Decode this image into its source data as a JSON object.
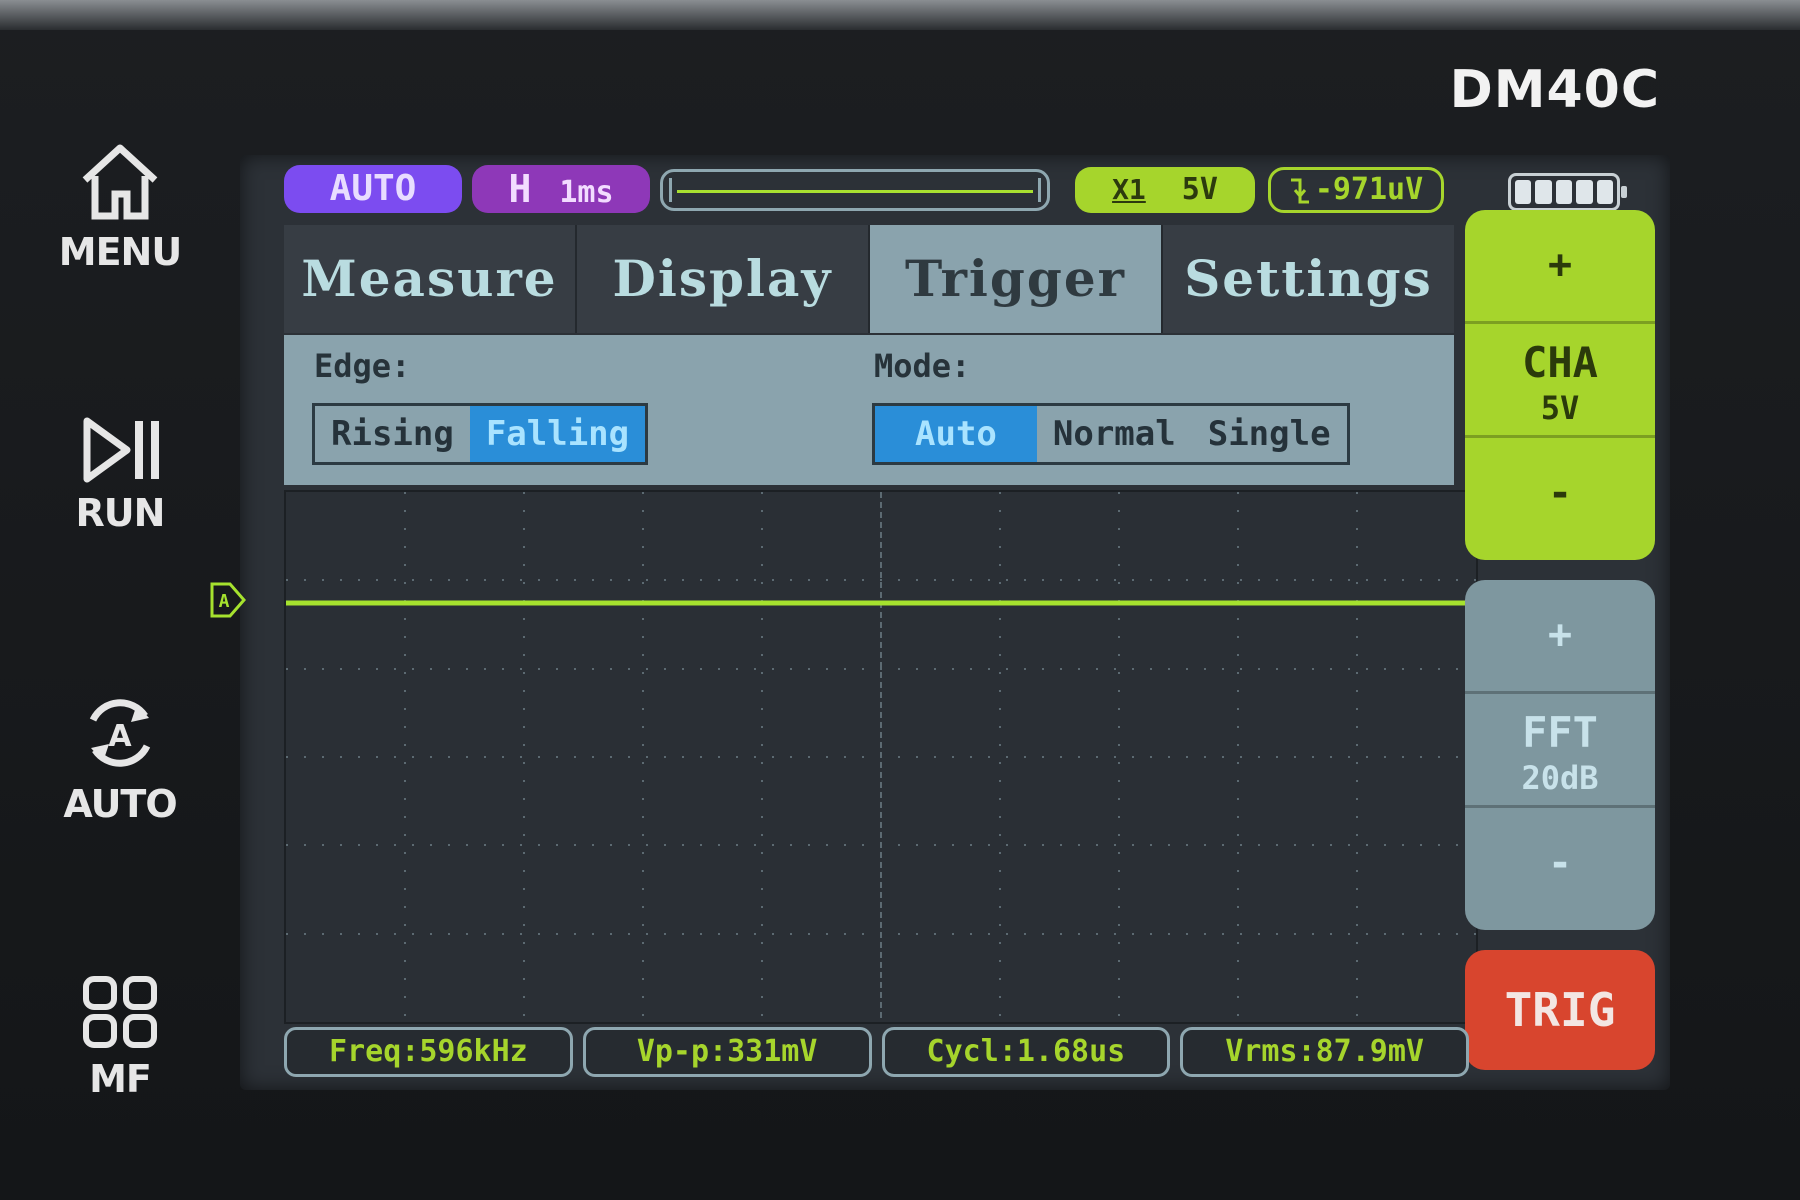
{
  "device": {
    "model": "DM40C"
  },
  "hardware_buttons": [
    {
      "label": "MENU",
      "icon": "home-icon"
    },
    {
      "label": "RUN",
      "icon": "play-pause-icon"
    },
    {
      "label": "AUTO",
      "icon": "auto-cycle-icon"
    },
    {
      "label": "MF",
      "icon": "grid-squares-icon"
    }
  ],
  "status": {
    "mode": "AUTO",
    "timebase_prefix": "H",
    "timebase_value": "1ms",
    "channel_coupling": "X1",
    "channel_scale": "5V",
    "trigger_level": "-971uV",
    "battery_level_fraction": 1.0
  },
  "tabs": [
    {
      "label": "Measure",
      "active": false
    },
    {
      "label": "Display",
      "active": false
    },
    {
      "label": "Trigger",
      "active": true
    },
    {
      "label": "Settings",
      "active": false
    }
  ],
  "trigger_panel": {
    "edge_label": "Edge:",
    "edge_options": [
      "Rising",
      "Falling"
    ],
    "edge_selected": "Falling",
    "mode_label": "Mode:",
    "mode_options": [
      "Auto",
      "Normal",
      "Single"
    ],
    "mode_selected": "Auto"
  },
  "waveform": {
    "channel_marker": "A",
    "trace_color": "#a6e22e",
    "level_fraction_from_top": 0.21
  },
  "side_controls": {
    "channel": {
      "plus": "+",
      "name": "CHA",
      "value": "5V",
      "minus": "-"
    },
    "fft": {
      "plus": "+",
      "name": "FFT",
      "value": "20dB",
      "minus": "-"
    },
    "trig": "TRIG"
  },
  "measurements": [
    "Freq:596kHz",
    "Vp-p:331mV",
    "Cycl:1.68us",
    "Vrms:87.9mV"
  ],
  "colors": {
    "auto_pill": "#7c4cf0",
    "timebase_pill": "#8e38b8",
    "channel_green": "#a6d52c",
    "selection_blue": "#2a8ed8",
    "trig_red": "#d8452e"
  }
}
